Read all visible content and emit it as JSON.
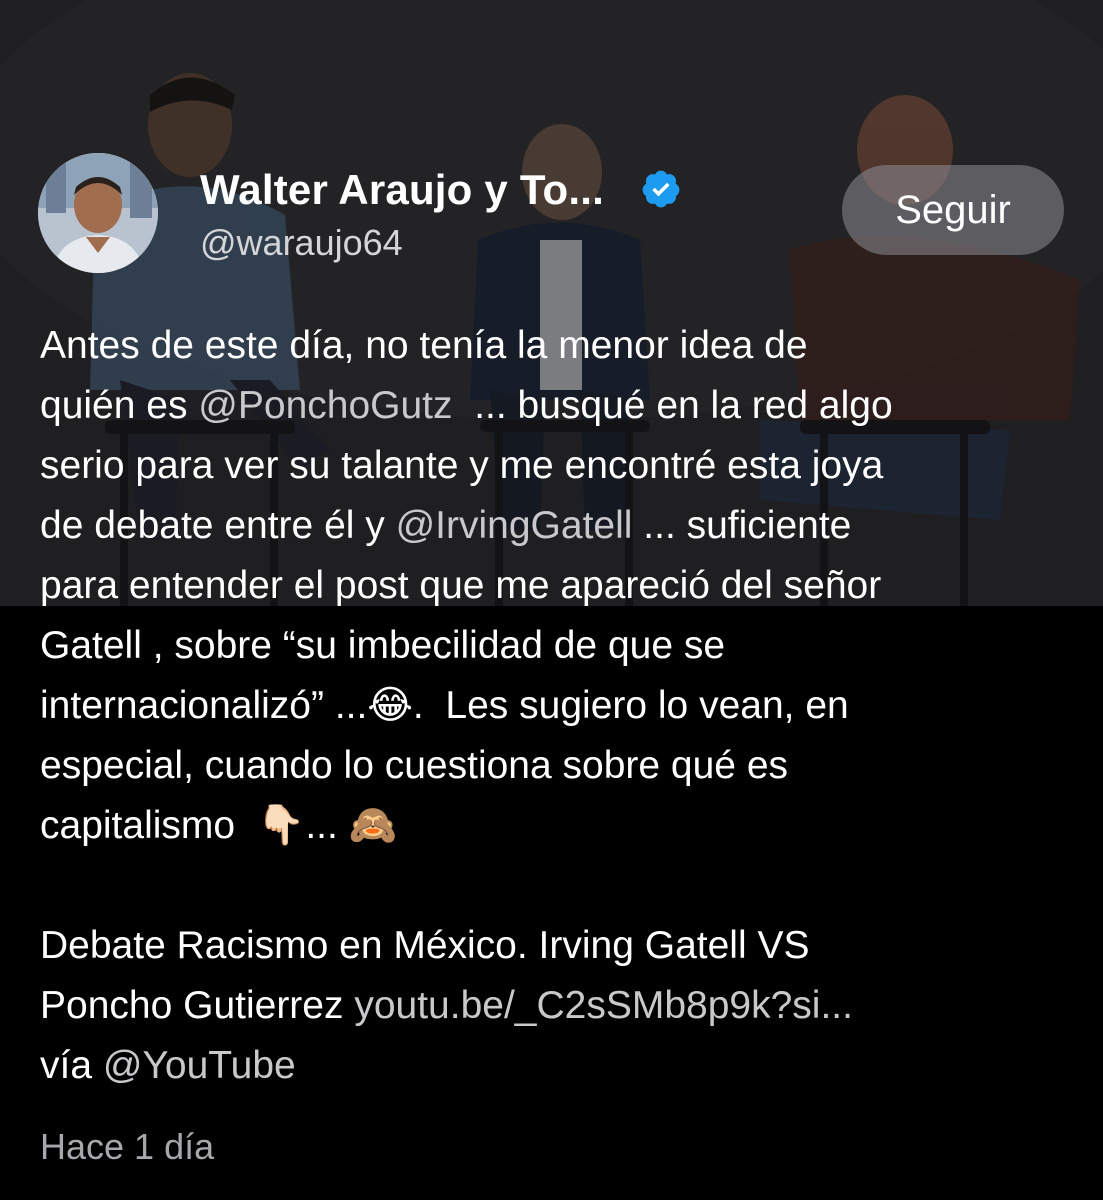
{
  "author": {
    "display_name": "Walter Araujo y To...",
    "handle": "@waraujo64",
    "verified": true
  },
  "follow_button": {
    "label": "Seguir"
  },
  "tweet": {
    "p1_t1": "Antes de este día, no tenía la menor idea de\nquién es ",
    "p1_m1": "@PonchoGutz",
    "p1_t2": "  ... busqué en la red algo\nserio para ver su talante y me encontré esta joya\nde debate entre él y ",
    "p1_m2": "@IrvingGatell",
    "p1_t3": " ... suficiente\npara entender el post que me apareció del señor\nGatell , sobre “su imbecilidad de que se\ninternacionalizó” ...",
    "emoji_laugh": "😂",
    "p1_t4": ".  Les sugiero lo vean, en\nespecial, cuando lo cuestiona sobre qué es\ncapitalismo  ",
    "emoji_point_down": "👇🏻",
    "p1_t5": "... ",
    "emoji_monkey": "🙈",
    "p2_t1": "\n\nDebate Racismo en México. Irving Gatell VS\nPoncho Gutierrez ",
    "p2_link": "youtu.be/_C2sSMb8p9k?si...",
    "p2_t2": "\nvía ",
    "p2_m1": "@YouTube"
  },
  "timestamp": "Hace 1 día",
  "colors": {
    "background": "#000000",
    "verified_badge": "#1d9bf0",
    "mention_link": "#c9c9cc",
    "timestamp": "#a8a8ac"
  },
  "icons": {
    "verified": "verified-badge-icon"
  }
}
